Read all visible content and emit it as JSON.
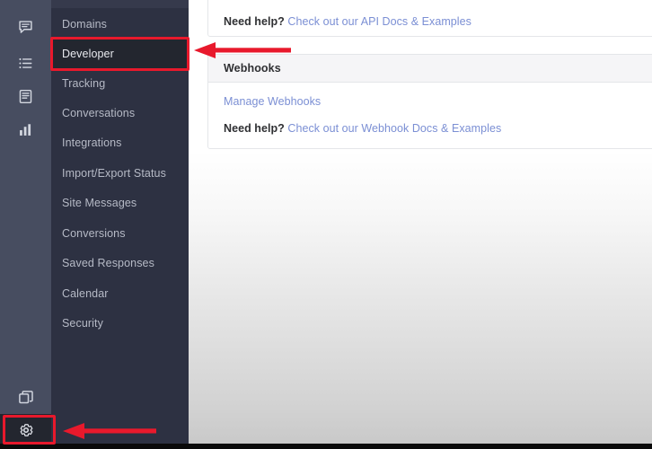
{
  "app": {
    "background_gradient_top": "#ffffff",
    "background_gradient_bottom": "#c9c9c9"
  },
  "icon_rail": {
    "background_color": "#474d60",
    "items": [
      {
        "icon": "chat-bubble-icon",
        "name": "conversations"
      },
      {
        "icon": "list-icon",
        "name": "lists"
      },
      {
        "icon": "document-icon",
        "name": "documents"
      },
      {
        "icon": "bar-chart-icon",
        "name": "reports"
      }
    ],
    "bottom_items": [
      {
        "icon": "copy-layers-icon",
        "name": "apps"
      },
      {
        "icon": "gear-icon",
        "name": "settings",
        "highlighted": true
      }
    ]
  },
  "sidebar": {
    "background_color": "#2d3142",
    "active_color": "#23262f",
    "items": [
      {
        "label": "Domains",
        "active": false
      },
      {
        "label": "Developer",
        "active": true
      },
      {
        "label": "Tracking",
        "active": false
      },
      {
        "label": "Conversations",
        "active": false
      },
      {
        "label": "Integrations",
        "active": false
      },
      {
        "label": "Import/Export Status",
        "active": false
      },
      {
        "label": "Site Messages",
        "active": false
      },
      {
        "label": "Conversions",
        "active": false
      },
      {
        "label": "Saved Responses",
        "active": false
      },
      {
        "label": "Calendar",
        "active": false
      },
      {
        "label": "Security",
        "active": false
      }
    ]
  },
  "main": {
    "api_card": {
      "need_help_label": "Need help?",
      "need_help_link": "Check out our API Docs & Examples"
    },
    "webhooks_card": {
      "header": "Webhooks",
      "manage_link": "Manage Webhooks",
      "need_help_label": "Need help?",
      "need_help_link": "Check out our Webhook Docs & Examples"
    }
  },
  "annotations": {
    "highlight_color": "#e8192c",
    "boxes": [
      {
        "target": "developer-menu-item"
      },
      {
        "target": "settings-gear-icon"
      }
    ],
    "arrows": [
      {
        "target": "developer-menu-item",
        "direction": "left"
      },
      {
        "target": "settings-gear-icon",
        "direction": "left"
      }
    ]
  }
}
